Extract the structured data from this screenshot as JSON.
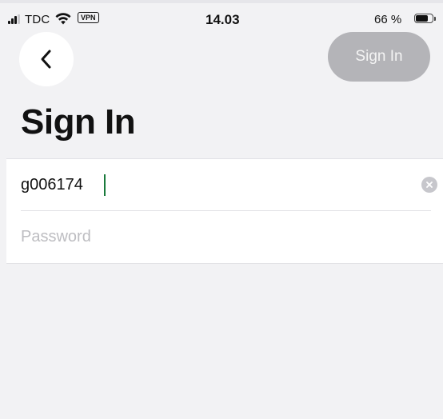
{
  "status_bar": {
    "carrier": "TDC",
    "vpn_badge": "VPN",
    "time": "14.03",
    "battery_percent": "66 %",
    "battery_level": 0.66
  },
  "nav": {
    "back_icon": "chevron-left-icon",
    "sign_in_button_label": "Sign In"
  },
  "page_title": "Sign In",
  "form": {
    "username_value": "g006174",
    "password_placeholder": "Password",
    "clear_icon": "clear-circle-icon"
  },
  "colors": {
    "background": "#f2f2f4",
    "disabled_button": "#b4b4b8",
    "caret": "#1a7a3c"
  }
}
